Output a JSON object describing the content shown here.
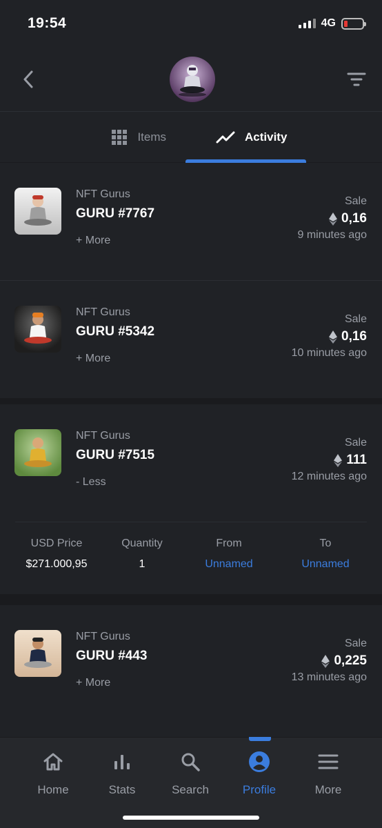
{
  "status_bar": {
    "time": "19:54",
    "network": "4G"
  },
  "header": {
    "avatar_icon": "meditating-guru-avatar"
  },
  "tabs": [
    {
      "label": "Items",
      "active": false
    },
    {
      "label": "Activity",
      "active": true
    }
  ],
  "activities": [
    {
      "collection": "NFT Gurus",
      "name": "GURU #7767",
      "toggle": "+ More",
      "event": "Sale",
      "price": "0,16",
      "time": "9 minutes ago",
      "expanded": false
    },
    {
      "collection": "NFT Gurus",
      "name": "GURU #5342",
      "toggle": "+ More",
      "event": "Sale",
      "price": "0,16",
      "time": "10 minutes ago",
      "expanded": false
    },
    {
      "collection": "NFT Gurus",
      "name": "GURU #7515",
      "toggle": "- Less",
      "event": "Sale",
      "price": "111",
      "time": "12 minutes ago",
      "expanded": true,
      "details": {
        "usd_price_label": "USD Price",
        "usd_price": "$271.000,95",
        "quantity_label": "Quantity",
        "quantity": "1",
        "from_label": "From",
        "from": "Unnamed",
        "to_label": "To",
        "to": "Unnamed"
      }
    },
    {
      "collection": "NFT Gurus",
      "name": "GURU #443",
      "toggle": "+ More",
      "event": "Sale",
      "price": "0,225",
      "time": "13 minutes ago",
      "expanded": false
    }
  ],
  "bottom_nav": [
    {
      "label": "Home",
      "icon": "home-icon",
      "active": false
    },
    {
      "label": "Stats",
      "icon": "stats-icon",
      "active": false
    },
    {
      "label": "Search",
      "icon": "search-icon",
      "active": false
    },
    {
      "label": "Profile",
      "icon": "profile-icon",
      "active": true
    },
    {
      "label": "More",
      "icon": "menu-icon",
      "active": false
    }
  ],
  "colors": {
    "accent": "#3b7dde",
    "background": "#202226",
    "muted_text": "#9a9ea6"
  }
}
